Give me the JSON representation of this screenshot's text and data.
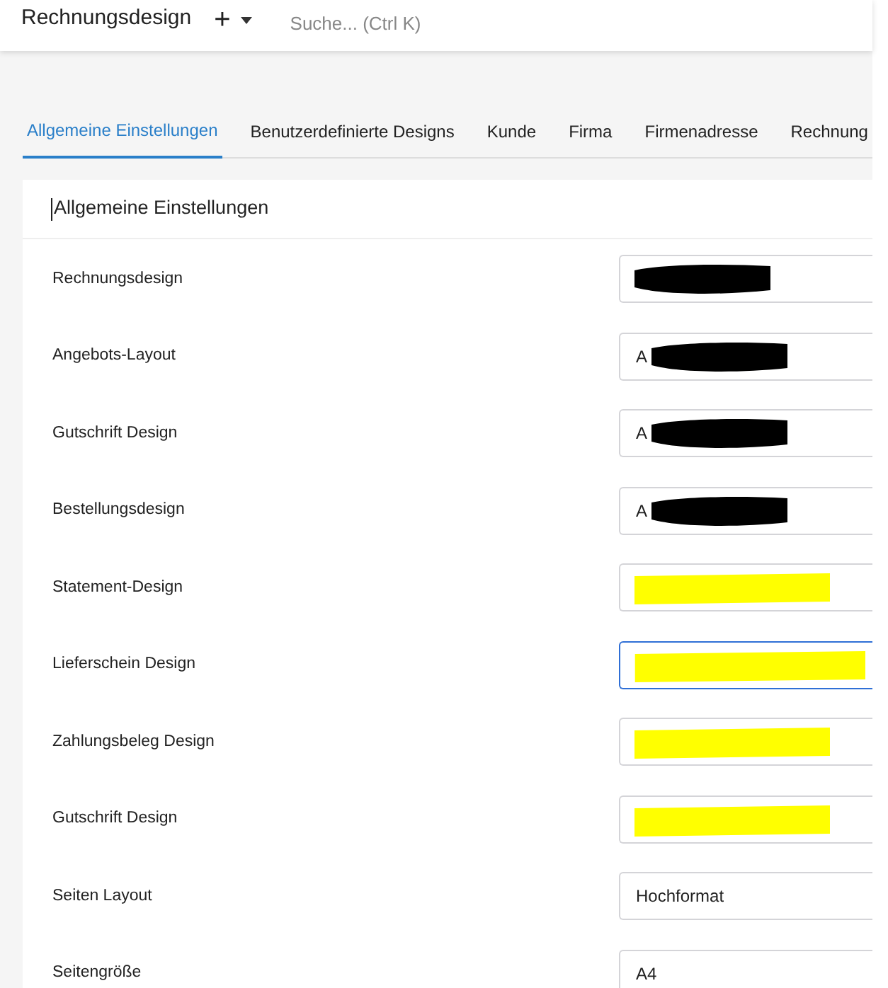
{
  "header": {
    "title": "Rechnungsdesign",
    "add_icon": "+",
    "search": {
      "placeholder": "Suche... (Ctrl K)"
    }
  },
  "tabs": [
    {
      "label": "Allgemeine Einstellungen",
      "selected": true
    },
    {
      "label": "Benutzerdefinierte Designs",
      "selected": false
    },
    {
      "label": "Kunde",
      "selected": false
    },
    {
      "label": "Firma",
      "selected": false
    },
    {
      "label": "Firmenadresse",
      "selected": false
    },
    {
      "label": "Rechnung",
      "selected": false
    }
  ],
  "card": {
    "title": "Allgemeine Einstellungen",
    "rows": [
      {
        "label": "Rechnungsdesign",
        "color": "#000000",
        "focused": false
      },
      {
        "label": "Angebots-Layout",
        "value": "A",
        "color": "#000000",
        "focused": false
      },
      {
        "label": "Gutschrift Design",
        "value": "A",
        "color": "#000000",
        "focused": false
      },
      {
        "label": "Bestellungsdesign",
        "value": "A",
        "color": "#000000",
        "focused": false
      },
      {
        "label": "Statement-Design",
        "color": "#ffff00",
        "focused": false
      },
      {
        "label": "Lieferschein Design",
        "color": "#ffff00",
        "focused": true
      },
      {
        "label": "Zahlungsbeleg Design",
        "color": "#ffff00",
        "focused": false
      },
      {
        "label": "Gutschrift Design",
        "color": "#ffff00",
        "focused": false
      },
      {
        "label": "Seiten Layout",
        "value": "Hochformat",
        "focused": false
      },
      {
        "label": "Seitengröße",
        "value": "A4",
        "focused": false
      }
    ]
  }
}
